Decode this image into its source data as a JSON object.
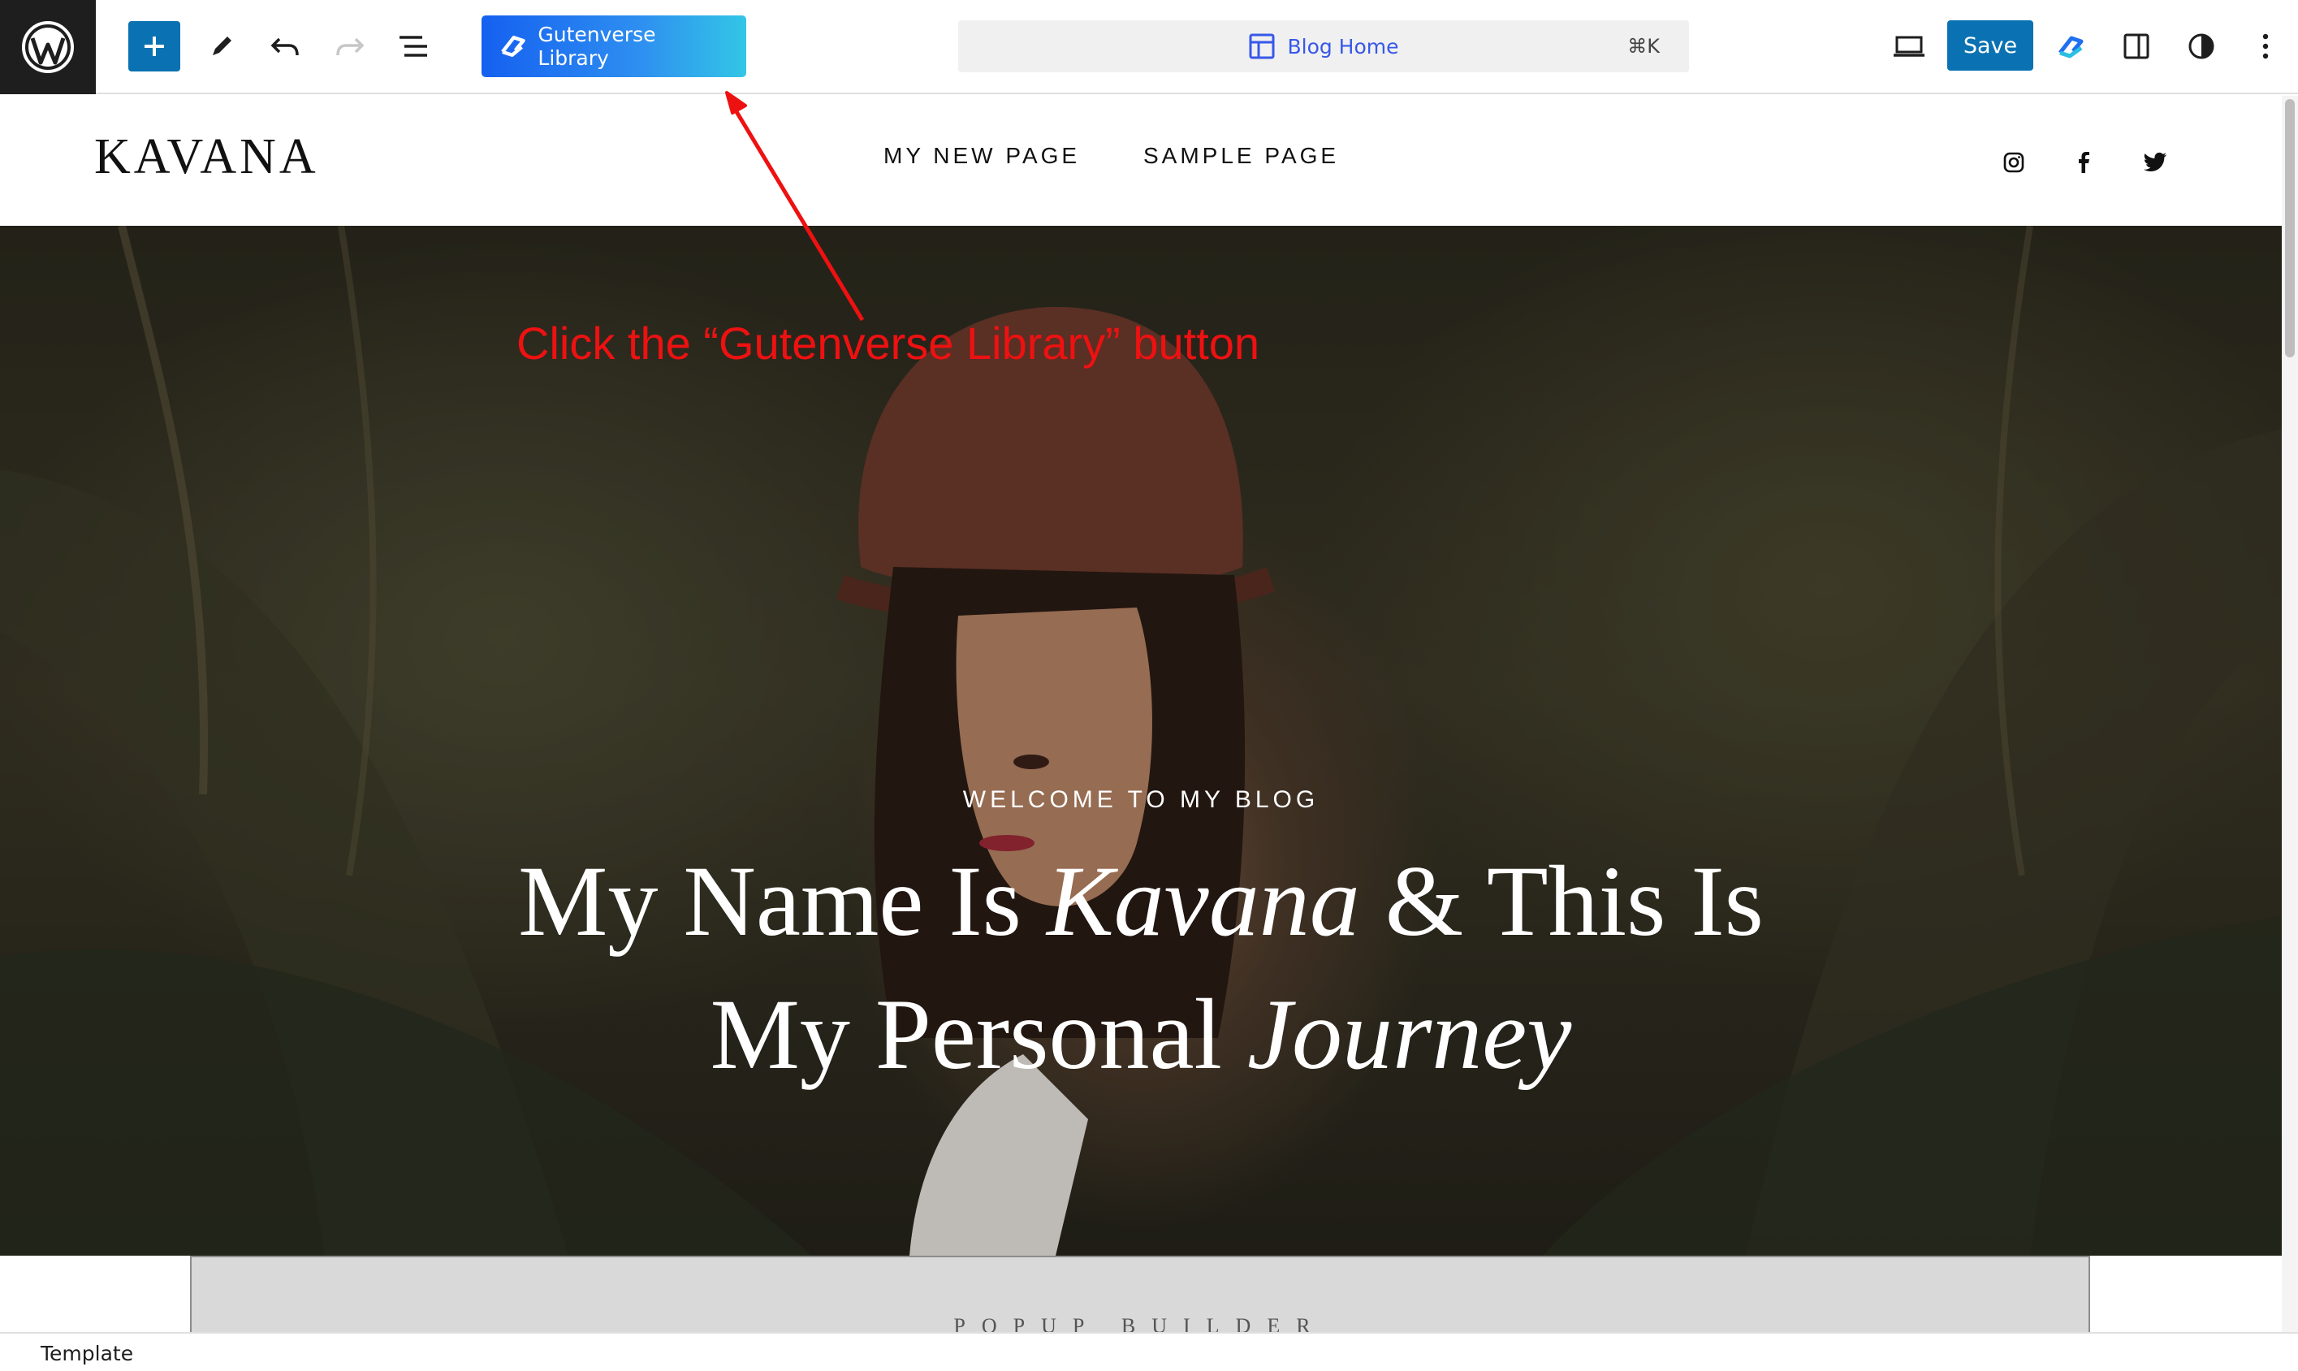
{
  "toolbar": {
    "add_label": "Add block",
    "library_button": "Gutenverse Library",
    "command_title": "Blog Home",
    "command_shortcut": "⌘K",
    "save_label": "Save"
  },
  "site": {
    "title": "KAVANA",
    "nav": [
      "MY NEW PAGE",
      "SAMPLE PAGE"
    ],
    "social": [
      "instagram-icon",
      "facebook-icon",
      "twitter-icon"
    ]
  },
  "hero": {
    "subtitle": "WELCOME TO MY BLOG",
    "heading_line1_a": "My Name Is ",
    "heading_line1_em": "Kavana",
    "heading_line1_b": " & This Is",
    "heading_line2_a": "My Personal ",
    "heading_line2_em": "Journey"
  },
  "annotation": {
    "text": "Click the “Gutenverse Library” button",
    "color": "#ee1111"
  },
  "below_section": {
    "text": "POPUP BUILDER"
  },
  "status": {
    "label": "Template"
  },
  "colors": {
    "accent": "#0a72b2",
    "library_gradient_start": "#1560f0",
    "library_gradient_end": "#33c6e6"
  }
}
